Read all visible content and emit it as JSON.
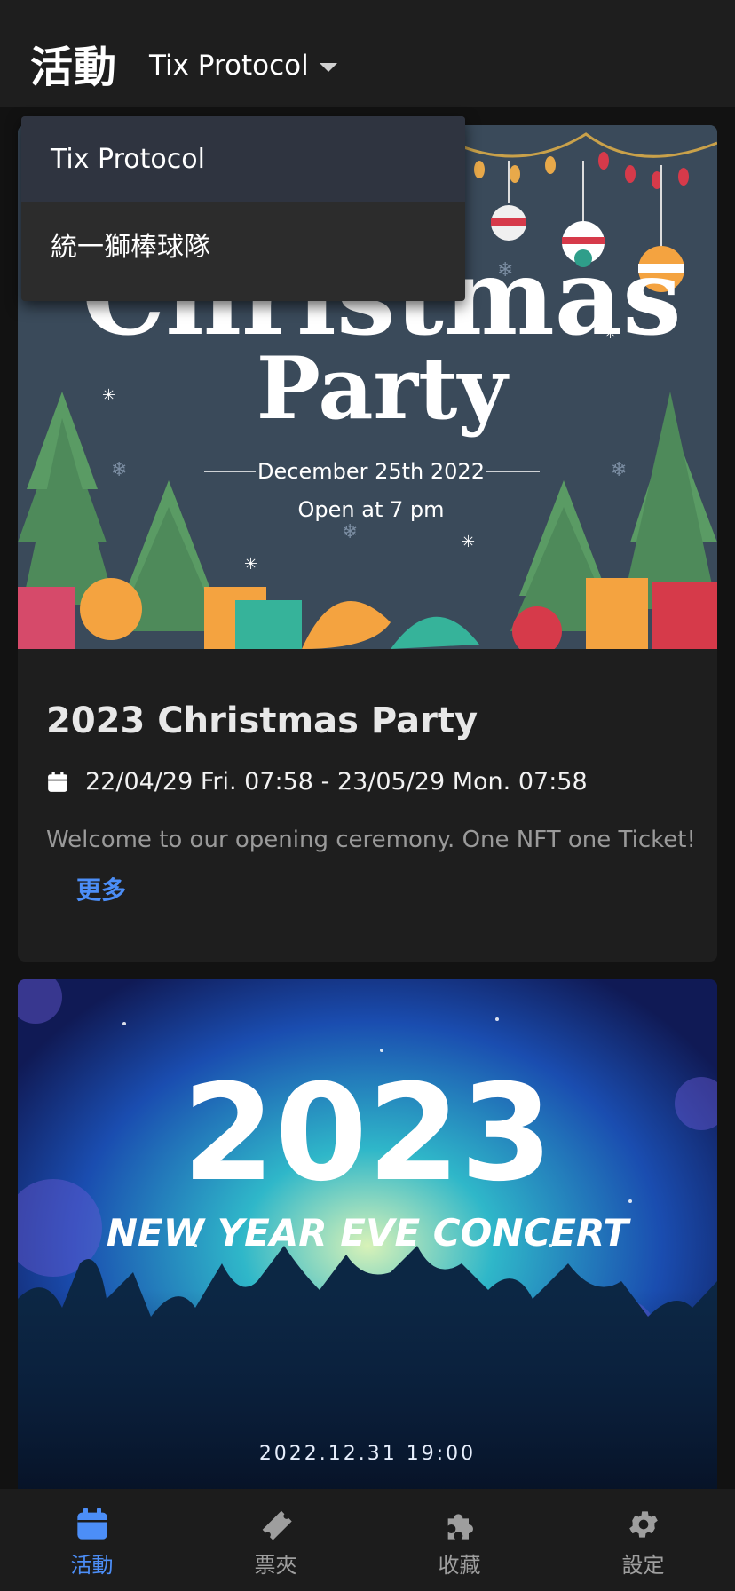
{
  "header": {
    "title": "活動",
    "org_selector": "Tix Protocol"
  },
  "dropdown": {
    "options": [
      "Tix Protocol",
      "統一獅棒球隊"
    ],
    "selected": "Tix Protocol"
  },
  "events": [
    {
      "banner": {
        "title_line1": "Christmas",
        "title_line2": "Party",
        "date": "December 25th 2022",
        "time": "Open at 7 pm"
      },
      "title": "2023 Christmas Party",
      "datetime": "22/04/29 Fri. 07:58 - 23/05/29 Mon. 07:58",
      "description": "Welcome to our opening ceremony. One NFT one Ticket!",
      "more": "更多"
    },
    {
      "banner": {
        "year": "2023",
        "subtitle": "NEW YEAR EVE CONCERT",
        "date": "2022.12.31 19:00"
      }
    }
  ],
  "bottom_nav": [
    {
      "label": "活動",
      "icon": "calendar-icon",
      "active": true
    },
    {
      "label": "票夾",
      "icon": "ticket-icon",
      "active": false
    },
    {
      "label": "收藏",
      "icon": "puzzle-icon",
      "active": false
    },
    {
      "label": "設定",
      "icon": "gear-icon",
      "active": false
    }
  ],
  "colors": {
    "accent": "#4c8ef7",
    "background": "#121212",
    "surface": "#1e1e1e"
  }
}
